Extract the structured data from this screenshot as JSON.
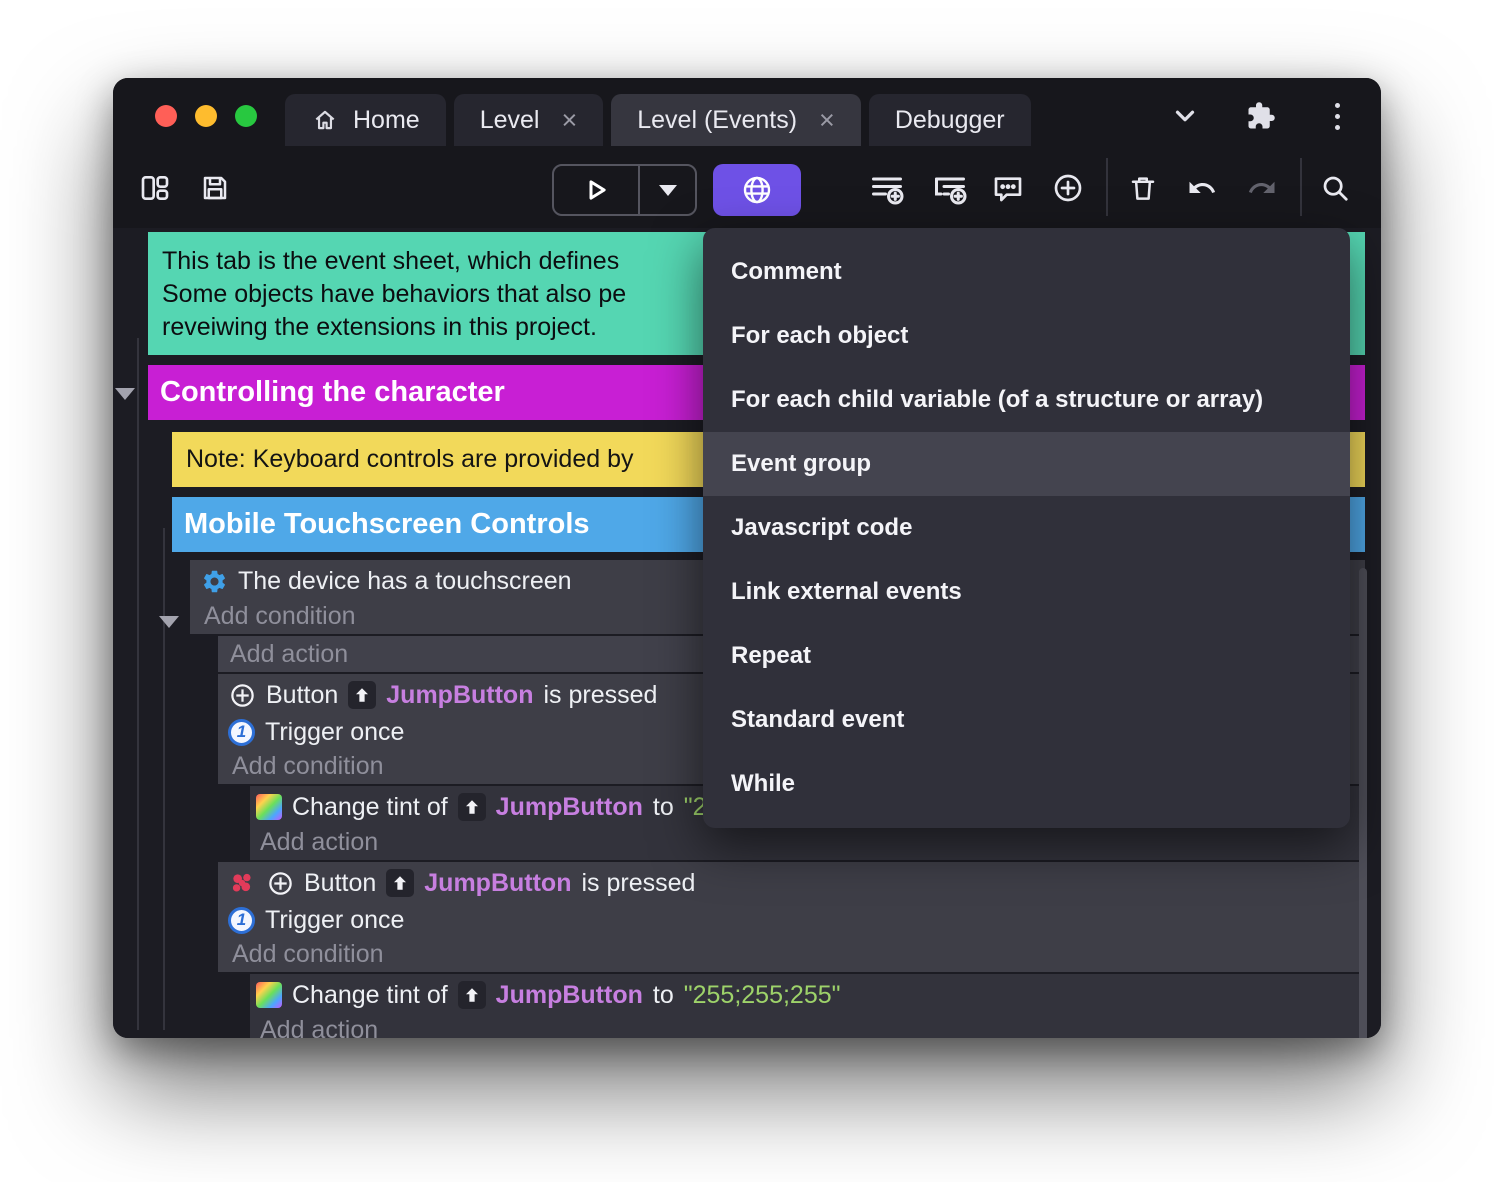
{
  "colors": {
    "accent_purple": "#6e51e6",
    "comment_green": "#55d6b2",
    "group_magenta": "#c81fd4",
    "note_yellow": "#f2d95a",
    "group_blue": "#4fa8e8",
    "object_purple": "#c77fe0",
    "value_green": "#9ed36a",
    "traffic_red": "#ff5f57",
    "traffic_yellow": "#febc2e",
    "traffic_green": "#28c840"
  },
  "titlebar": {
    "tabs": [
      {
        "label": "Home",
        "active": false
      },
      {
        "label": "Level",
        "active": false,
        "close_glyph": "×"
      },
      {
        "label": "Level (Events)",
        "active": true,
        "close_glyph": "×"
      },
      {
        "label": "Debugger",
        "active": false
      }
    ]
  },
  "toolbar": {
    "icons": [
      "panels",
      "save",
      "play",
      "play-options",
      "network-preview-globe",
      "add-event",
      "add-subevent",
      "add-comment",
      "choose-add-event",
      "trash",
      "undo",
      "redo",
      "search"
    ]
  },
  "context_menu": {
    "items": [
      {
        "label": "Comment",
        "highlighted": false
      },
      {
        "label": "For each object",
        "highlighted": false
      },
      {
        "label": "For each child variable (of a structure or array)",
        "highlighted": false
      },
      {
        "label": "Event group",
        "highlighted": true
      },
      {
        "label": "Javascript code",
        "highlighted": false
      },
      {
        "label": "Link external events",
        "highlighted": false
      },
      {
        "label": "Repeat",
        "highlighted": false
      },
      {
        "label": "Standard event",
        "highlighted": false
      },
      {
        "label": "While",
        "highlighted": false
      }
    ]
  },
  "sheet": {
    "comment": {
      "line1": "This tab is the event sheet, which defines",
      "line2": "Some objects have behaviors that also pe",
      "line3": "reveiwing the extensions in this project."
    },
    "group_controlling": "Controlling the character",
    "note": "Note: Keyboard controls are provided by",
    "group_mobile": "Mobile Touchscreen Controls",
    "add_condition": "Add condition",
    "add_action": "Add action",
    "touch_condition": "The device has a touchscreen",
    "button_event": {
      "prefix": "Button",
      "object": "JumpButton",
      "suffix": "is pressed"
    },
    "trigger_once": "Trigger once",
    "tint_action": {
      "prefix": "Change tint of",
      "object": "JumpButton",
      "to": "to",
      "value": "\"255;255;255\""
    },
    "icons": {
      "trigger_once_glyph": "1"
    }
  }
}
